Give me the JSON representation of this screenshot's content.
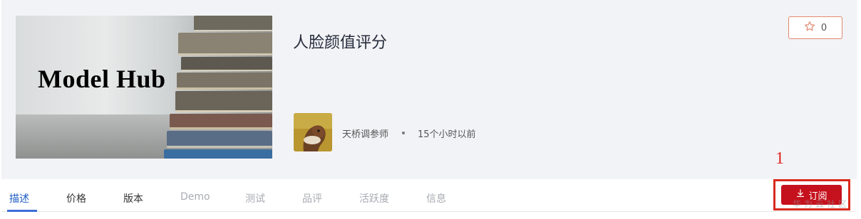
{
  "cover": {
    "title": "Model Hub"
  },
  "model": {
    "title": "人脸颜值评分"
  },
  "favorite": {
    "count": "0",
    "icon": "star-icon"
  },
  "author": {
    "name": "天桥调参师",
    "time": "15个小时以前"
  },
  "tabs": [
    {
      "label": "描述"
    },
    {
      "label": "价格"
    },
    {
      "label": "版本"
    },
    {
      "label": "Demo"
    },
    {
      "label": "测试"
    },
    {
      "label": "品评"
    },
    {
      "label": "活跃度"
    },
    {
      "label": "信息"
    }
  ],
  "subscribe": {
    "label": "订阅",
    "icon": "download-icon"
  },
  "annotation": {
    "number": "1"
  },
  "watermark": {
    "text": "华为云社区"
  },
  "colors": {
    "accent": "#c5111d",
    "active_tab": "#1f5fc4",
    "annotation": "#d9291d"
  }
}
